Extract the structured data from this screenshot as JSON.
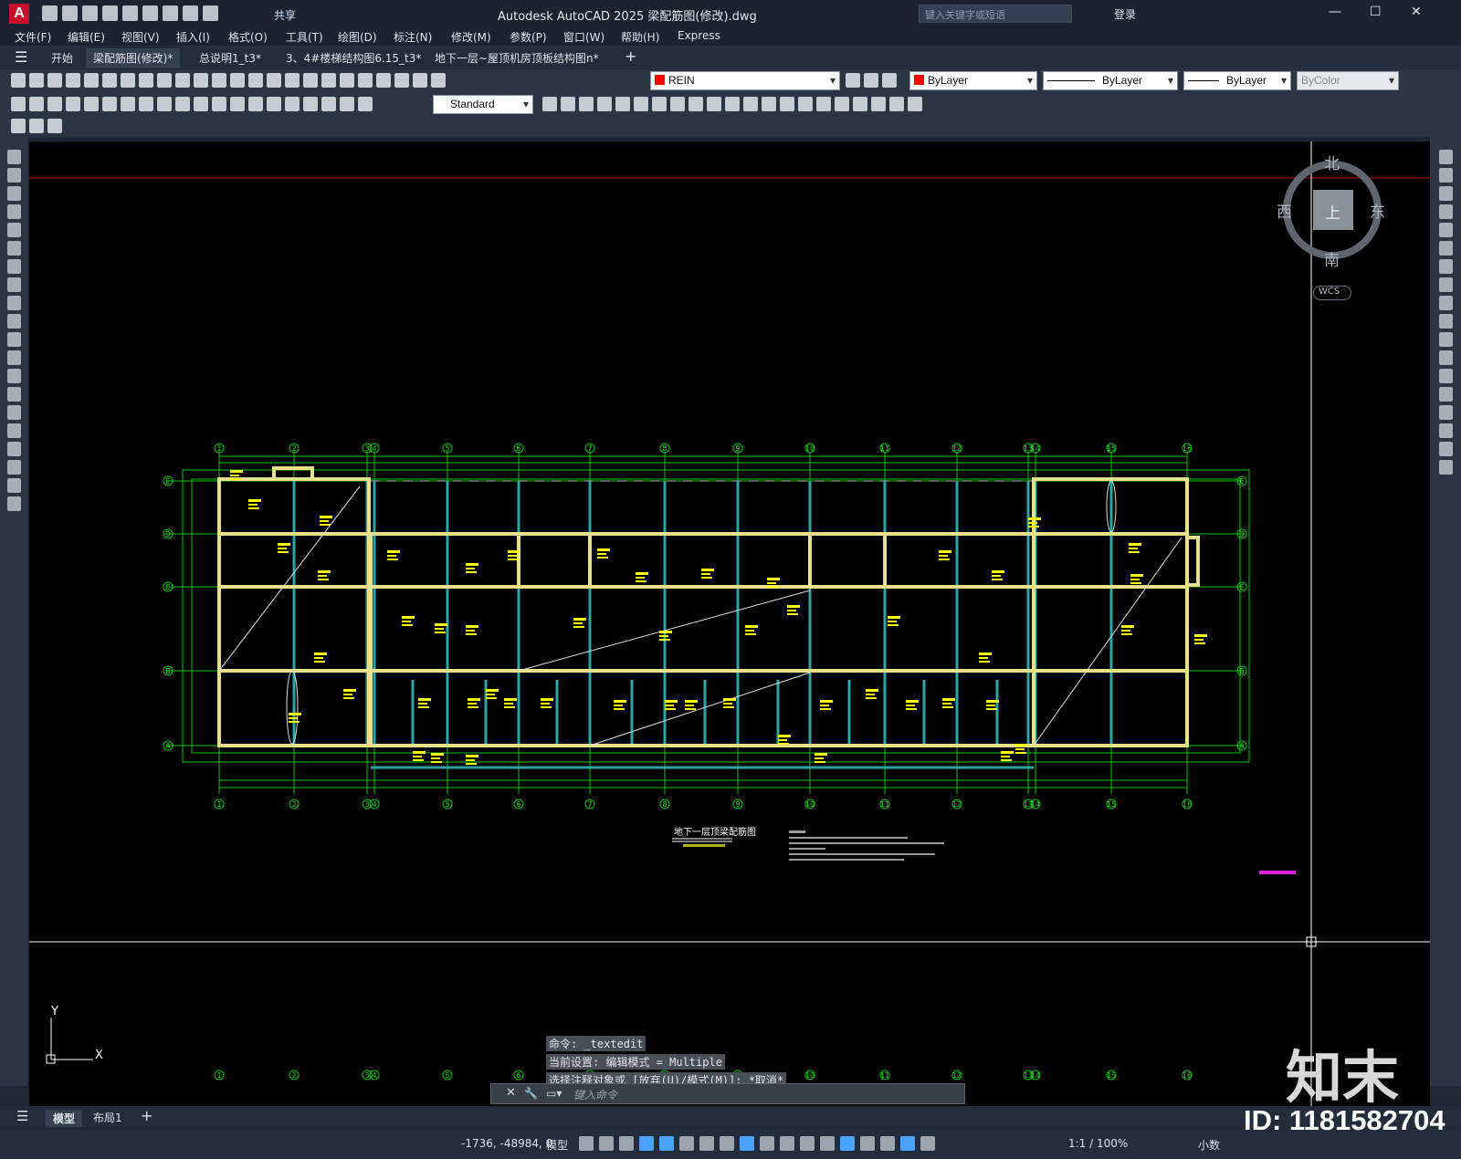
{
  "titlebar": {
    "share_label": "共享",
    "title": "Autodesk AutoCAD 2025    梁配筋图(修改).dwg",
    "search_placeholder": "键入关键字或短语",
    "login_label": "登录"
  },
  "menu": [
    "文件(F)",
    "编辑(E)",
    "视图(V)",
    "插入(I)",
    "格式(O)",
    "工具(T)",
    "绘图(D)",
    "标注(N)",
    "修改(M)",
    "参数(P)",
    "窗口(W)",
    "帮助(H)",
    "Express"
  ],
  "doc_tabs": [
    "开始",
    "梁配筋图(修改)*",
    "总说明1_t3*",
    "3、4#楼梯结构图6.15_t3*",
    "地下一层~屋顶机房顶板结构图n*"
  ],
  "properties": {
    "layer": "REIN",
    "color": "ByLayer",
    "linetype": "ByLayer",
    "lineweight": "ByLayer",
    "plotstyle": "ByColor",
    "text_style": "Standard"
  },
  "viewcube": {
    "north": "北",
    "south": "南",
    "east": "东",
    "west": "西",
    "face": "上",
    "wcs": "WCS"
  },
  "drawing": {
    "grid_numbers": [
      "1",
      "2",
      "3",
      "4",
      "5",
      "6",
      "7",
      "8",
      "9",
      "10",
      "11",
      "12",
      "13",
      "14",
      "15",
      "16"
    ],
    "grid_letters": [
      "E",
      "D",
      "C",
      "B",
      "A"
    ],
    "plan_title": "地下一层顶梁配筋图"
  },
  "command": {
    "history": [
      "命令: _textedit",
      "当前设置: 编辑模式 = Multiple",
      "选择注释对象或 [放弃(U)/模式(M)]: *取消*"
    ],
    "placeholder": "键入命令"
  },
  "layout_tabs": [
    "模型",
    "布局1"
  ],
  "status": {
    "coords": "-1736, -48984, 0",
    "model": "模型",
    "scale": "1:1 / 100%",
    "units": "小数"
  },
  "watermark": {
    "brand": "知末",
    "id": "ID: 1181582704"
  },
  "colors": {
    "beam": "#e8e08a",
    "grid": "#00c800",
    "wall": "#2aa6a6",
    "text": "#ffff00",
    "crosshair": "#ffffff"
  }
}
